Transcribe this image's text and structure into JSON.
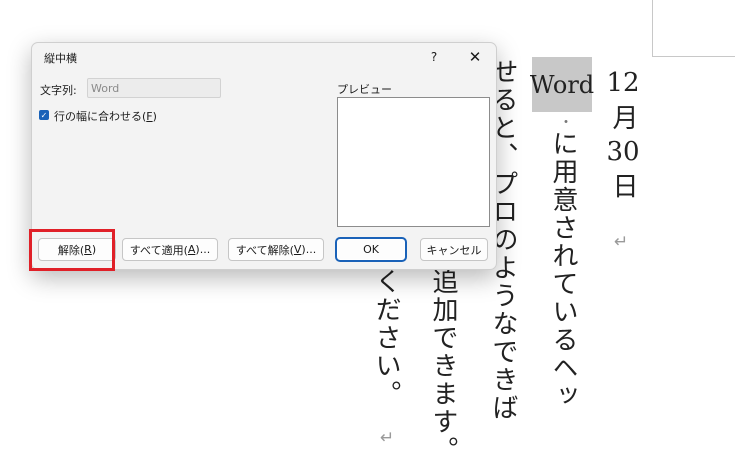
{
  "dialog": {
    "title": "縦中横",
    "help_label": "?",
    "close_label": "✕",
    "text_label": "文字列:",
    "text_value": "Word",
    "checkbox_label_prefix": "行の幅に合わせる(",
    "checkbox_accel": "F",
    "checkbox_label_suffix": ")",
    "checkbox_checked": true,
    "preview_label": "プレビュー",
    "buttons": {
      "release_prefix": "解除(",
      "release_accel": "R",
      "release_suffix": ")",
      "apply_all_prefix": "すべて適用(",
      "apply_all_accel": "A",
      "apply_all_suffix": ")...",
      "release_all_prefix": "すべて解除(",
      "release_all_accel": "V",
      "release_all_suffix": ")...",
      "ok": "OK",
      "cancel": "キャンセル"
    }
  },
  "document": {
    "date_num": "12",
    "date_month": "月",
    "date_day_num": "30",
    "date_day": "日",
    "word_highlight": "Word",
    "dot": "・",
    "col2": "に用意されているヘッ",
    "col3": "せると、プロのようなできば",
    "col4": "追加できます。",
    "col5": "ください。",
    "para_mark": "↵"
  },
  "highlight_color": "#e02028",
  "accent_color": "#1a62b8"
}
